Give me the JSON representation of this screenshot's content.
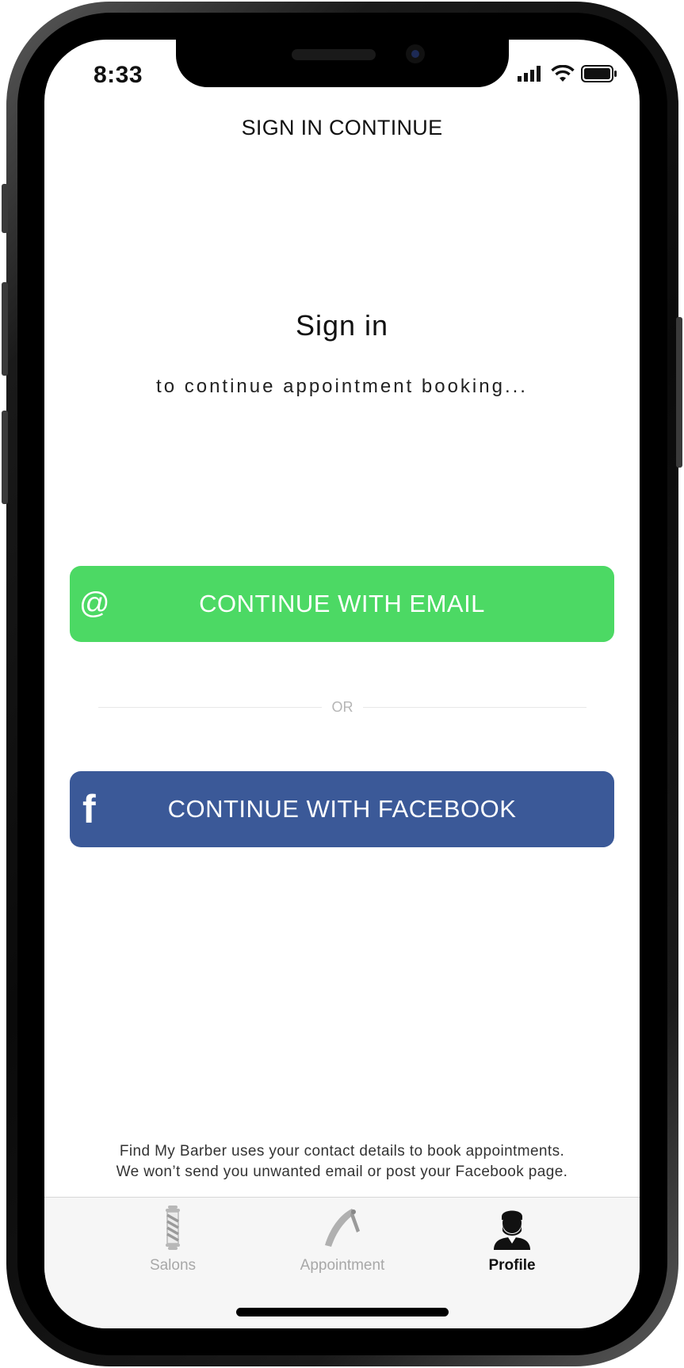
{
  "status_bar": {
    "time": "8:33"
  },
  "nav": {
    "title": "SIGN IN CONTINUE"
  },
  "content": {
    "heading": "Sign in",
    "subheading": "to continue appointment booking..."
  },
  "buttons": {
    "email": {
      "label": "CONTINUE WITH EMAIL",
      "icon": "at-icon",
      "color": "#4cd964"
    },
    "divider": "OR",
    "facebook": {
      "label": "CONTINUE WITH FACEBOOK",
      "icon": "facebook-icon",
      "color": "#3b5998"
    }
  },
  "footer": {
    "line1": "Find My Barber uses your contact details to book appointments.",
    "line2": "We won’t send you unwanted email or post your Facebook page."
  },
  "tabbar": {
    "tabs": [
      {
        "label": "Salons",
        "icon": "barber-pole-icon",
        "active": false
      },
      {
        "label": "Appointment",
        "icon": "razor-icon",
        "active": false
      },
      {
        "label": "Profile",
        "icon": "bearded-man-icon",
        "active": true
      }
    ]
  }
}
